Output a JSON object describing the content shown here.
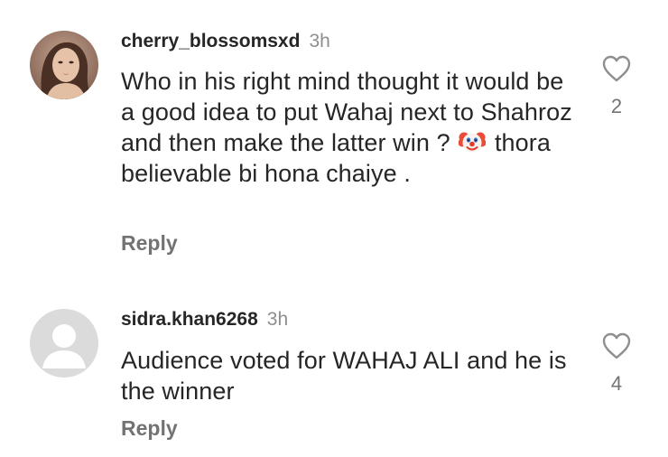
{
  "comments": [
    {
      "username": "cherry_blossomsxd",
      "time": "3h",
      "text_before_emoji": "Who in his right mind thought it would be a good idea to put Wahaj next to Shahroz and then make the latter win ?",
      "emoji": "clown-face-icon",
      "text_after_emoji": "thora believable bi hona chaiye .",
      "reply_label": "Reply",
      "like_count": "2"
    },
    {
      "username": "sidra.khan6268",
      "time": "3h",
      "text": "Audience voted for WAHAJ ALI and he is the winner",
      "reply_label": "Reply",
      "like_count": "4"
    }
  ],
  "colors": {
    "primary_text": "#262626",
    "secondary_text": "#8e8e8e",
    "reply_text": "#737373",
    "default_avatar_bg": "#dbdbdb",
    "default_avatar_fg": "#ffffff"
  }
}
